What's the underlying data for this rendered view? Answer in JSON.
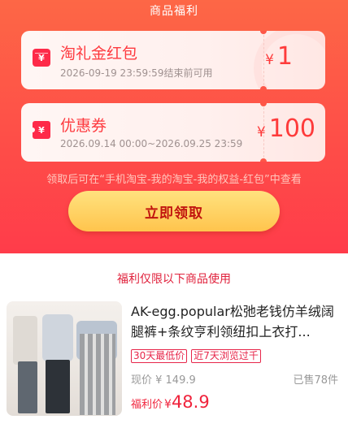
{
  "header": {
    "title": "商品福利"
  },
  "cards": [
    {
      "name": "淘礼金红包",
      "subtitle": "2026-09-19 23:59:59结束前可用",
      "currency": "¥",
      "value": "1",
      "icon": "red-envelope-icon"
    },
    {
      "name": "优惠券",
      "subtitle": "2026.09.14 00:00~2026.09.25 23:59",
      "currency": "¥",
      "value": "100",
      "icon": "coupon-icon"
    }
  ],
  "tip": "领取后可在“手机淘宝-我的淘宝-我的权益-红包”中查看",
  "claim_button": "立即领取",
  "section_title": "福利仅限以下商品使用",
  "product": {
    "title": "AK-egg.popular松弛老钱仿羊绒阔腿裤+条纹亨利领纽扣上衣打...",
    "tags": [
      "30天最低价",
      "近7天浏览过千"
    ],
    "now_price_label": "现价 ¥ 149.9",
    "sold": "已售78件",
    "welfare_label": "福利价",
    "welfare_currency": "¥",
    "welfare_price": "48.9"
  },
  "colors": {
    "accent": "#fe3a3f",
    "button_gold": "#ffc44d",
    "button_text": "#c1140f"
  }
}
